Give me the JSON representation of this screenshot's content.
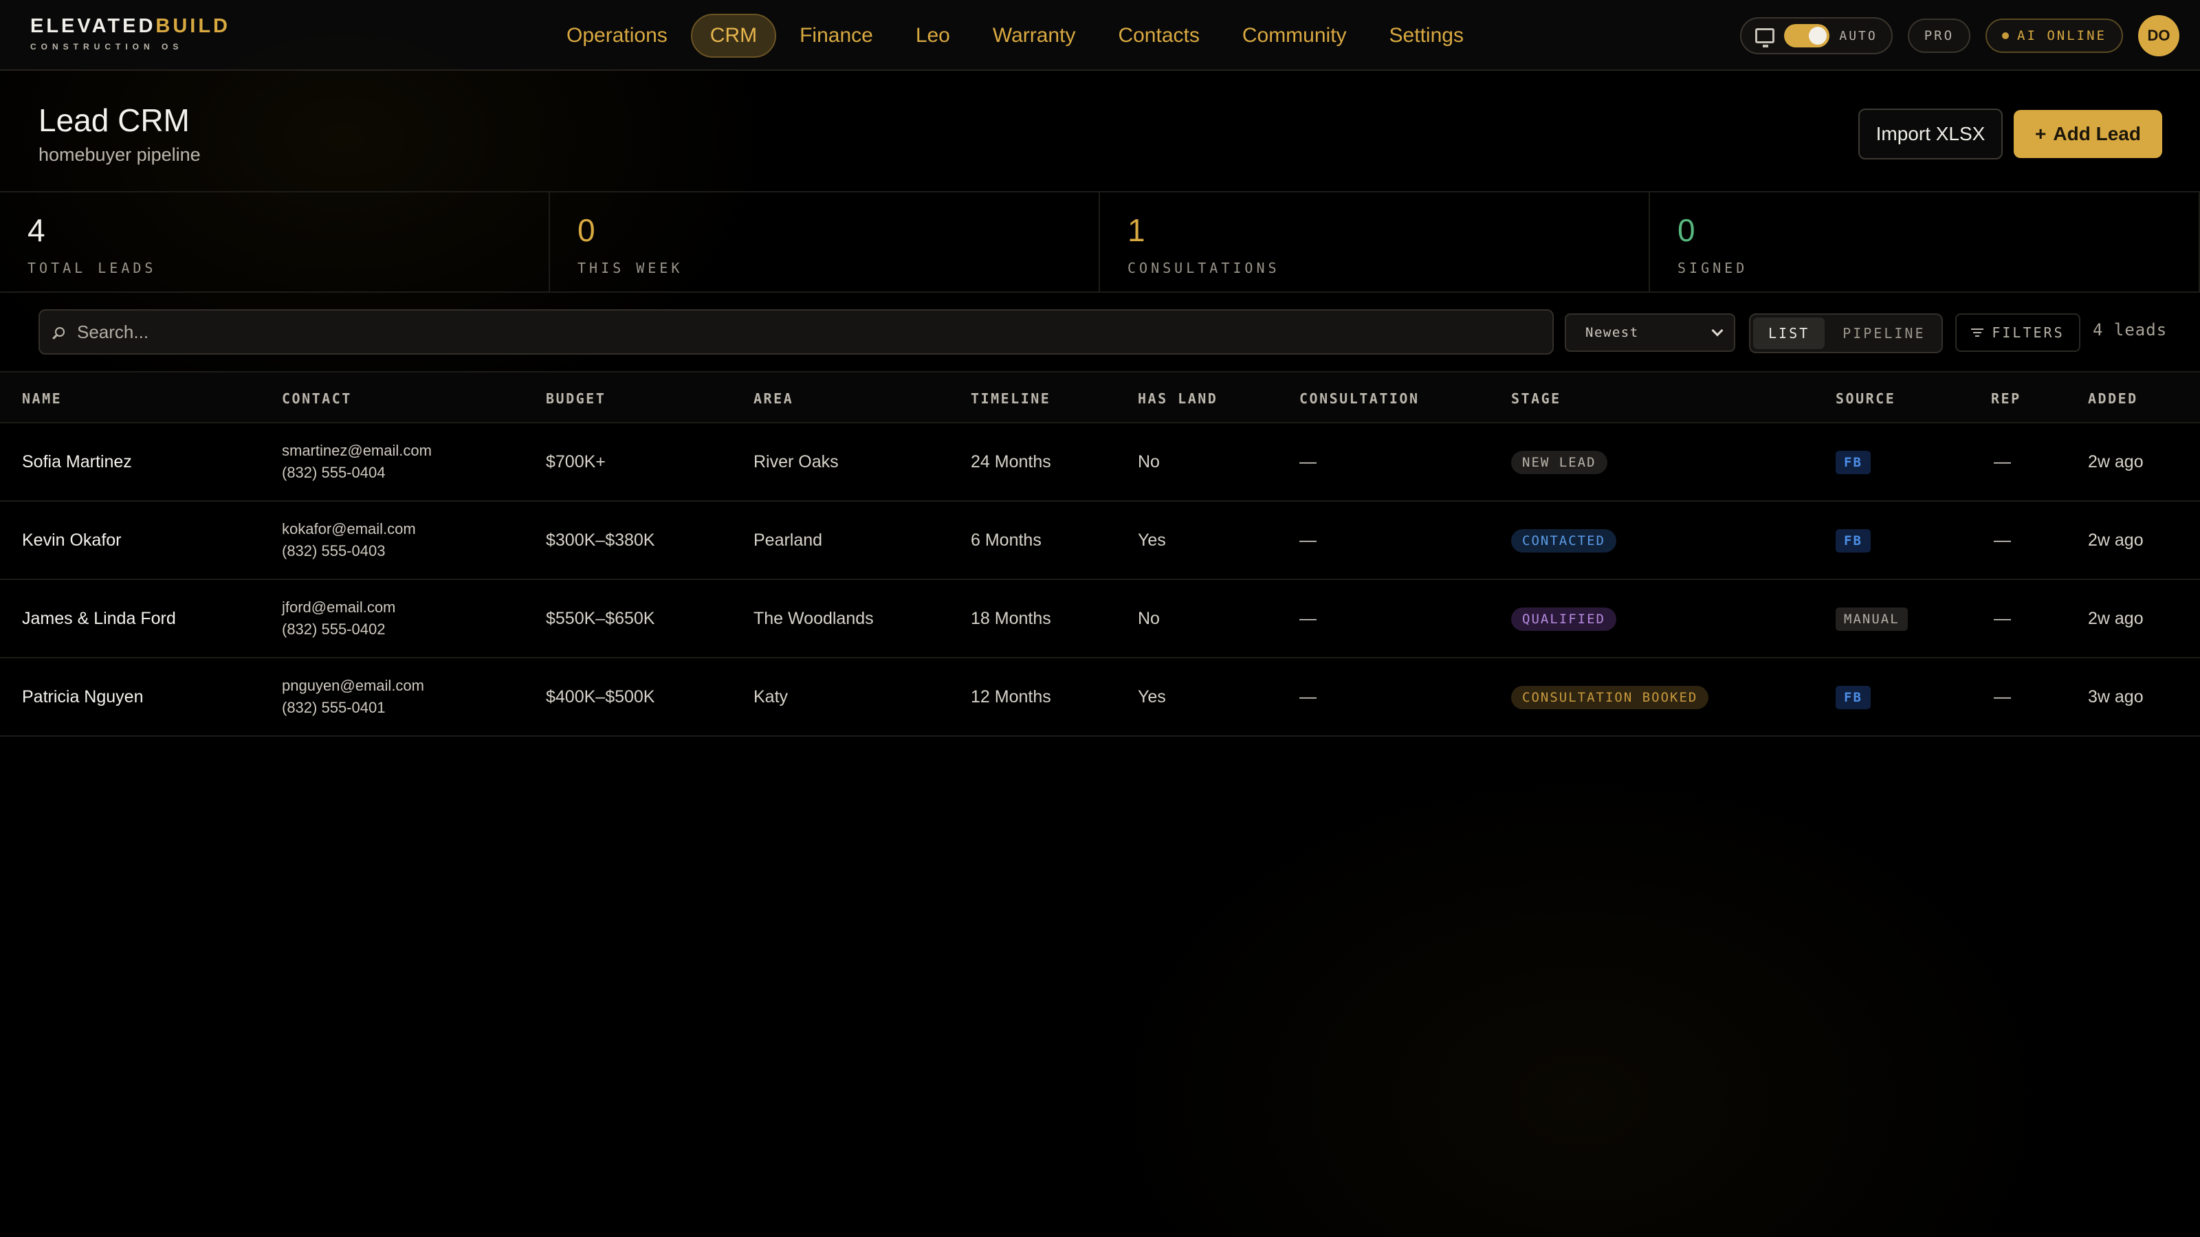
{
  "brand": {
    "name_main": "ELEVATED",
    "name_accent": "BUILD",
    "subtitle": "CONSTRUCTION OS"
  },
  "nav": [
    {
      "label": "Operations",
      "active": false
    },
    {
      "label": "CRM",
      "active": true
    },
    {
      "label": "Finance",
      "active": false
    },
    {
      "label": "Leo",
      "active": false
    },
    {
      "label": "Warranty",
      "active": false
    },
    {
      "label": "Contacts",
      "active": false
    },
    {
      "label": "Community",
      "active": false
    },
    {
      "label": "Settings",
      "active": false
    }
  ],
  "topright": {
    "auto_label": "AUTO",
    "pro_label": "PRO",
    "ai_status": "AI ONLINE",
    "avatar_initials": "DO"
  },
  "header": {
    "title": "Lead CRM",
    "subtitle": "homebuyer pipeline",
    "import_label": "Import XLSX",
    "add_label": "Add Lead",
    "add_icon": "+"
  },
  "stats": [
    {
      "value": "4",
      "label": "TOTAL LEADS",
      "color": "#f1efe9"
    },
    {
      "value": "0",
      "label": "THIS WEEK",
      "color": "#d9a941"
    },
    {
      "value": "1",
      "label": "CONSULTATIONS",
      "color": "#d9a941"
    },
    {
      "value": "0",
      "label": "SIGNED",
      "color": "#58b77e"
    }
  ],
  "toolbar": {
    "search_placeholder": "Search...",
    "sort_value": "Newest",
    "view_list": "LIST",
    "view_pipeline": "PIPELINE",
    "filters_label": "FILTERS",
    "lead_count": "4 leads"
  },
  "table": {
    "headers": [
      "NAME",
      "CONTACT",
      "BUDGET",
      "AREA",
      "TIMELINE",
      "HAS LAND",
      "CONSULTATION",
      "STAGE",
      "SOURCE",
      "REP",
      "ADDED"
    ],
    "rows": [
      {
        "name": "Sofia Martinez",
        "email": "smartinez@email.com",
        "phone": "(832) 555-0404",
        "budget": "$700K+",
        "area": "River Oaks",
        "timeline": "24 Months",
        "has_land": "No",
        "consultation": "—",
        "stage": "NEW LEAD",
        "stage_kind": "new",
        "source": "FB",
        "source_kind": "fb",
        "rep": "—",
        "added": "2w ago"
      },
      {
        "name": "Kevin Okafor",
        "email": "kokafor@email.com",
        "phone": "(832) 555-0403",
        "budget": "$300K–$380K",
        "area": "Pearland",
        "timeline": "6 Months",
        "has_land": "Yes",
        "consultation": "—",
        "stage": "CONTACTED",
        "stage_kind": "contacted",
        "source": "FB",
        "source_kind": "fb",
        "rep": "—",
        "added": "2w ago"
      },
      {
        "name": "James & Linda Ford",
        "email": "jford@email.com",
        "phone": "(832) 555-0402",
        "budget": "$550K–$650K",
        "area": "The Woodlands",
        "timeline": "18 Months",
        "has_land": "No",
        "consultation": "—",
        "stage": "QUALIFIED",
        "stage_kind": "qualified",
        "source": "MANUAL",
        "source_kind": "manual",
        "rep": "—",
        "added": "2w ago"
      },
      {
        "name": "Patricia Nguyen",
        "email": "pnguyen@email.com",
        "phone": "(832) 555-0401",
        "budget": "$400K–$500K",
        "area": "Katy",
        "timeline": "12 Months",
        "has_land": "Yes",
        "consultation": "—",
        "stage": "CONSULTATION BOOKED",
        "stage_kind": "booked",
        "source": "FB",
        "source_kind": "fb",
        "rep": "—",
        "added": "3w ago"
      }
    ]
  },
  "colors": {
    "accent": "#d9a941",
    "stage_new_bg": "#1f1e1c",
    "stage_new_fg": "#b9b4aa",
    "stage_contacted_bg": "#10213a",
    "stage_contacted_fg": "#5b9be6",
    "stage_qualified_bg": "#2a1838",
    "stage_qualified_fg": "#b58be0",
    "stage_booked_bg": "#2e2410",
    "stage_booked_fg": "#c99a3d",
    "src_fb_bg": "#0f2040",
    "src_fb_fg": "#4d8fe8",
    "src_manual_bg": "#222120",
    "src_manual_fg": "#b3aea4"
  }
}
